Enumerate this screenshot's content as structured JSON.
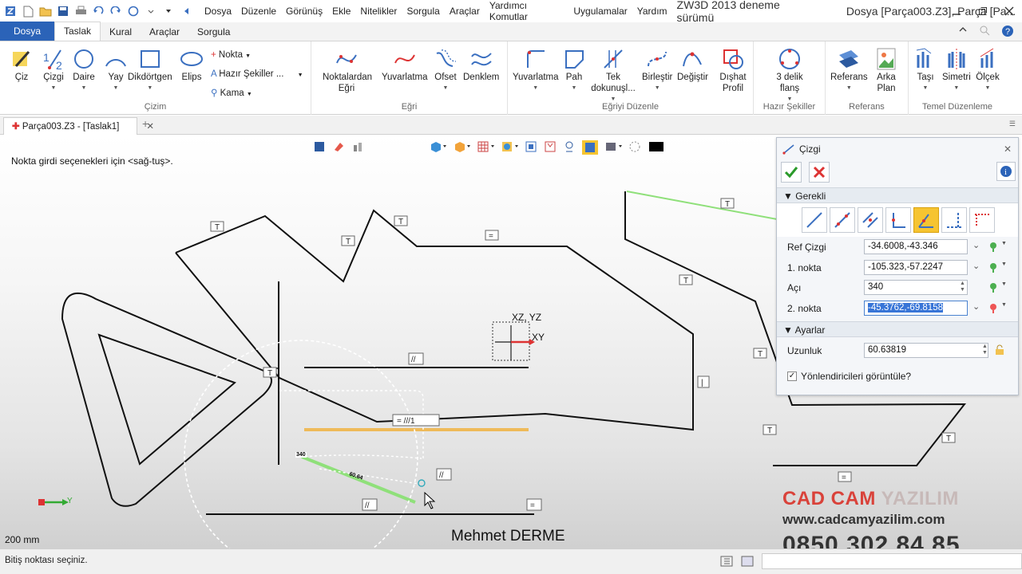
{
  "titlebar": {
    "menus": [
      "Dosya",
      "Düzenle",
      "Görünüş",
      "Ekle",
      "Nitelikler",
      "Sorgula",
      "Araçlar",
      "Yardımcı Komutlar",
      "Uygulamalar",
      "Yardım"
    ],
    "app_title": "ZW3D 2013 deneme sürümü",
    "doc_title": "Dosya [Parça003.Z3],  Parça [Pa..."
  },
  "ribbon_tabs": {
    "file": "Dosya",
    "tabs": [
      "Taslak",
      "Kural",
      "Araçlar",
      "Sorgula"
    ],
    "active": "Taslak"
  },
  "ribbon": {
    "cizim": {
      "label": "Çizim",
      "buttons": [
        "Çiz",
        "Çizgi",
        "Daire",
        "Yay",
        "Dikdörtgen",
        "Elips"
      ],
      "small": [
        "Nokta",
        "Hazır Şekiller ...",
        "Kama"
      ]
    },
    "egri": {
      "label": "Eğri",
      "buttons": [
        "Noktalardan Eğri",
        "Yuvarlatma",
        "Ofset",
        "Denklem"
      ]
    },
    "egriyi_duzenle": {
      "label": "Eğriyi Düzenle",
      "buttons": [
        "Yuvarlatma",
        "Pah",
        "Tek dokunuşl...",
        "Birleştir",
        "Değiştir",
        "Dışhat Profil"
      ]
    },
    "hazir_sekiller": {
      "label": "Hazır Şekiller",
      "buttons": [
        "3 delik flanş"
      ]
    },
    "referans": {
      "label": "Referans",
      "buttons": [
        "Referans",
        "Arka Plan"
      ]
    },
    "temel_duzenleme": {
      "label": "Temel Düzenleme",
      "buttons": [
        "Taşı",
        "Simetri",
        "Ölçek"
      ]
    }
  },
  "doc_tab": {
    "label": "Parça003.Z3 - [Taslak1]"
  },
  "viewport": {
    "hint": "Nokta girdi seçenekleri için <sağ-tuş>.",
    "scale": "200 mm",
    "author": "Mehmet DERME",
    "axis_labels": [
      "XZ, YZ",
      "XY"
    ],
    "small_label": "Y",
    "dim_angle": "340",
    "dim_length": "60.64"
  },
  "brand": {
    "name_red": "CAD CAM",
    "name_grey": "YAZILIM",
    "url": "www.cadcamyazilim.com",
    "phone": "0850 302 84 85"
  },
  "panel": {
    "title": "Çizgi",
    "section_required": "Gerekli",
    "section_settings": "Ayarlar",
    "fields": [
      {
        "label": "Ref Çizgi",
        "value": "-34.6008,-43.346"
      },
      {
        "label": "1. nokta",
        "value": "-105.323,-57.2247"
      },
      {
        "label": "Açı",
        "value": "340"
      },
      {
        "label": "2. nokta",
        "value": "-45.3762,-69.8158"
      }
    ],
    "length": {
      "label": "Uzunluk",
      "value": "60.63819"
    },
    "checkbox_label": "Yönlendiricileri görüntüle?",
    "checkbox_checked": true
  },
  "statusbar": {
    "text": "Bitiş noktası seçiniz."
  },
  "colors": {
    "file_tab": "#2b63b8",
    "accent_yellow": "#f6c431",
    "brand_red": "#d9423a",
    "green_line": "#8fe07a",
    "orange_line": "#f0b64a"
  }
}
